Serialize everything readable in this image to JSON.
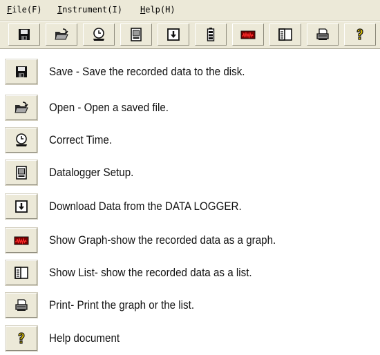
{
  "menu": {
    "file": {
      "label": "ile(F)",
      "accel": "F"
    },
    "instrument": {
      "label": "nstrument(I)",
      "accel": "I"
    },
    "help": {
      "label": "elp(H)",
      "accel": "H"
    }
  },
  "toolbar": {
    "buttons": [
      "save-icon",
      "open-folder-icon",
      "clock-icon",
      "datalogger-icon",
      "download-icon",
      "battery-icon",
      "graph-icon",
      "list-icon",
      "printer-icon",
      "help-icon"
    ]
  },
  "legend": [
    {
      "icon": "save-icon",
      "text": "Save - Save the recorded data to the disk."
    },
    {
      "icon": "open-folder-icon",
      "text": "Open - Open a saved file."
    },
    {
      "icon": "clock-icon",
      "text": "Correct Time."
    },
    {
      "icon": "datalogger-icon",
      "text": "Datalogger Setup."
    },
    {
      "icon": "download-icon",
      "text": "Download Data from the DATA LOGGER."
    },
    {
      "icon": "graph-icon",
      "text": "Show Graph-show the recorded data as a graph."
    },
    {
      "icon": "list-icon",
      "text": "Show List- show the recorded data as a list."
    },
    {
      "icon": "printer-icon",
      "text": "Print- Print the graph or the list."
    },
    {
      "icon": "help-icon",
      "text": "Help document"
    }
  ],
  "colors": {
    "chrome": "#ece9d8",
    "graph_bg": "#7a0000",
    "graph_line": "#ff2a2a",
    "help_yellow": "#f2d200"
  }
}
